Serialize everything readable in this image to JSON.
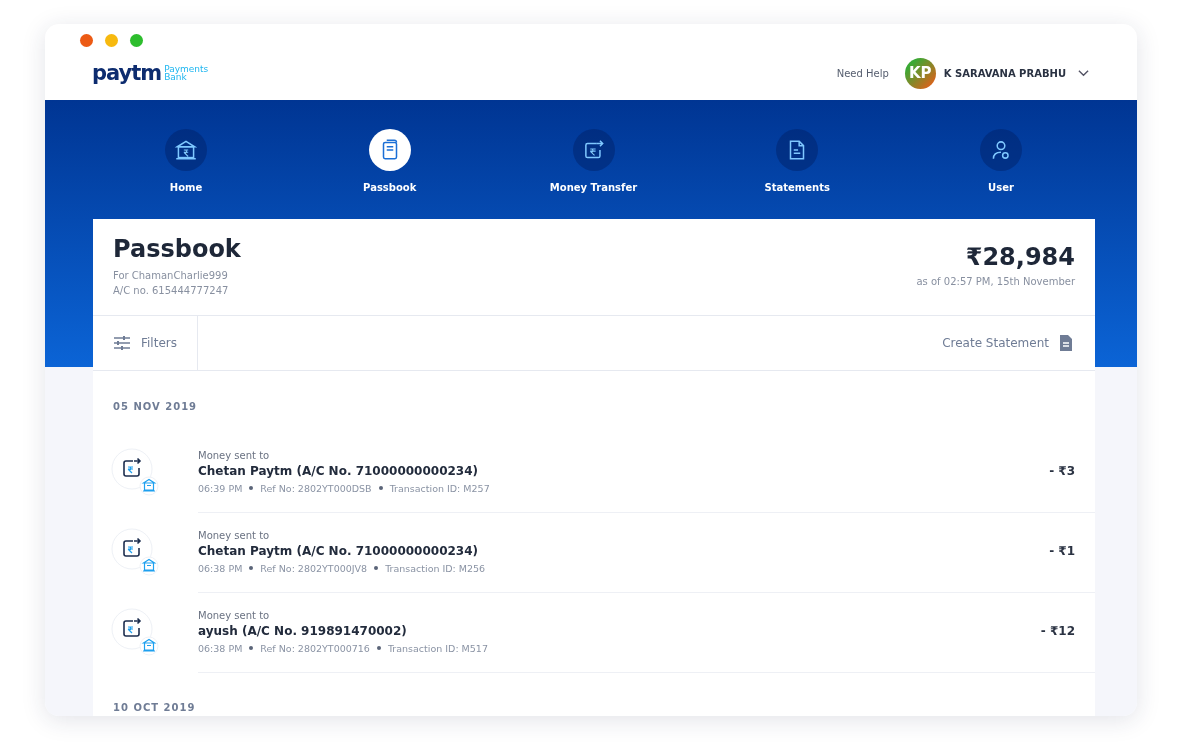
{
  "logo": {
    "brand": "paytm",
    "sub_lines": [
      "Payments",
      "Bank"
    ]
  },
  "header": {
    "help_link": "Need Help",
    "avatar_initials": "KP",
    "user_name": "K SARAVANA PRABHU"
  },
  "nav": [
    {
      "label": "Home",
      "selected": false
    },
    {
      "label": "Passbook",
      "selected": true
    },
    {
      "label": "Money Transfer",
      "selected": false
    },
    {
      "label": "Statements",
      "selected": false
    },
    {
      "label": "User",
      "selected": false
    }
  ],
  "passbook": {
    "title": "Passbook",
    "owner": "For ChamanCharlie999",
    "account": "A/C no. 615444777247",
    "balance": "₹28,984",
    "balance_time": "as of 02:57 PM, 15th November"
  },
  "toolbar": {
    "filters": "Filters",
    "create_statement": "Create Statement"
  },
  "groups": [
    {
      "date": "05 NOV 2019",
      "transactions": [
        {
          "caption": "Money sent to",
          "party": "Chetan Paytm (A/C No. 71000000000234)",
          "time": "06:39 PM",
          "ref": "Ref No: 2802YT000DSB",
          "txn_id": "Transaction ID: M257",
          "amount": "- ₹3"
        },
        {
          "caption": "Money sent to",
          "party": "Chetan Paytm (A/C No. 71000000000234)",
          "time": "06:38 PM",
          "ref": "Ref No: 2802YT000JV8",
          "txn_id": "Transaction ID: M256",
          "amount": "- ₹1"
        },
        {
          "caption": "Money sent to",
          "party": "ayush (A/C No. 919891470002)",
          "time": "06:38 PM",
          "ref": "Ref No: 2802YT000716",
          "txn_id": "Transaction ID: M517",
          "amount": "- ₹12"
        }
      ]
    },
    {
      "date": "10 OCT 2019"
    }
  ]
}
